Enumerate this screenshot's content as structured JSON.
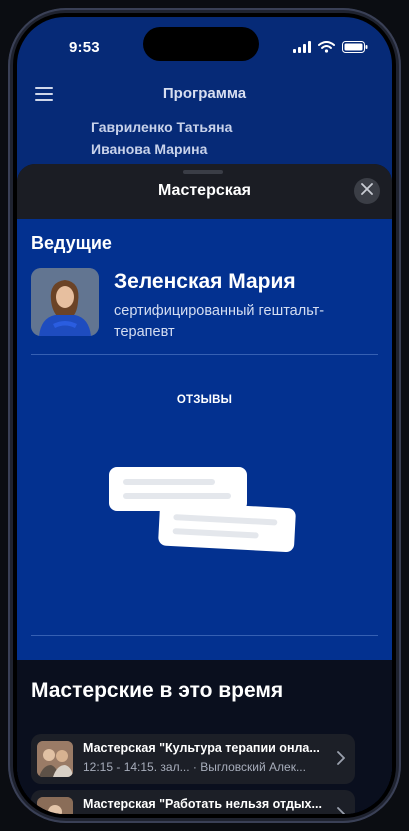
{
  "status_bar": {
    "time": "9:53"
  },
  "nav": {
    "title": "Программа"
  },
  "behind_list": {
    "line1": "Гавриленко Татьяна",
    "line2": "Иванова Марина"
  },
  "sheet": {
    "title": "Мастерская",
    "section_title": "Ведущие",
    "presenter": {
      "name": "Зеленская Мария",
      "role": "сертифицированный гештальт-терапевт"
    },
    "reviews_label": "ОТЗЫВЫ"
  },
  "same_time": {
    "title": "Мастерские в это время",
    "items": [
      {
        "title": "Мастерская \"Культура терапии онла...",
        "meta": "12:15 - 14:15. зал... · Выгловский Алек..."
      },
      {
        "title": "Мастерская \"Работать нельзя отдых...",
        "meta": ""
      }
    ]
  },
  "colors": {
    "blue_panel": "#033190",
    "background_blue": "#062a77",
    "sheet_header": "#1b1d24",
    "dark_section": "#0a0f1e"
  },
  "icons": [
    "menu-icon",
    "signal-icon",
    "wifi-icon",
    "battery-icon",
    "close-icon",
    "chevron-right-icon"
  ]
}
